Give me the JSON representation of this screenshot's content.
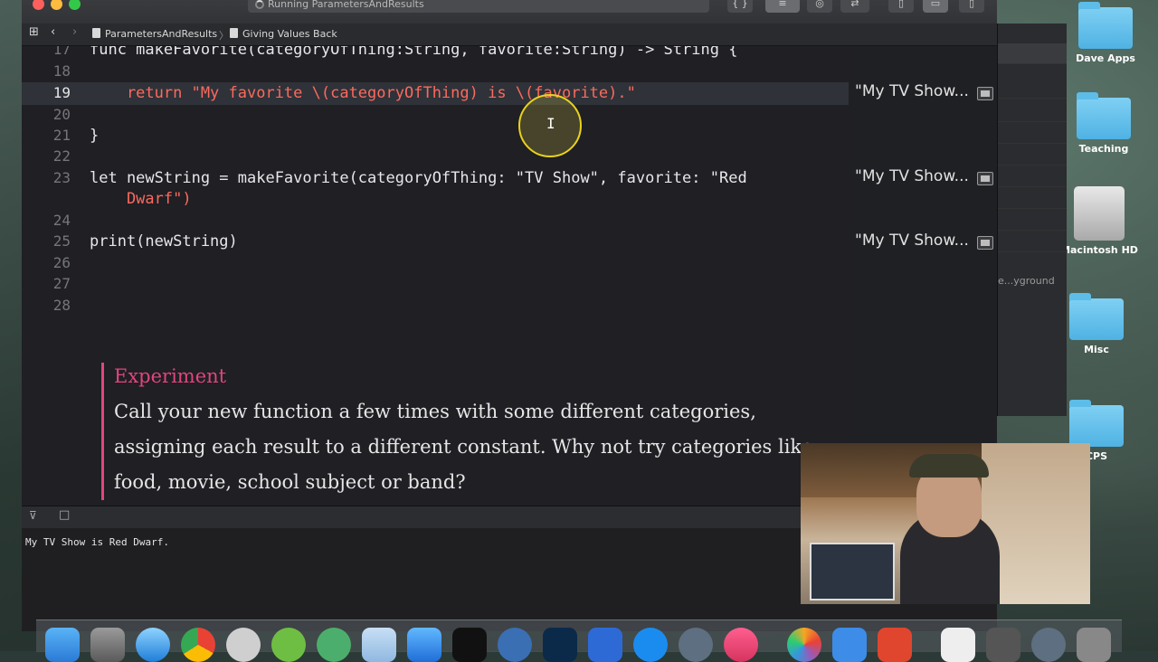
{
  "window": {
    "activity_text": "Running ParametersAndResults",
    "breadcrumb_project": "ParametersAndResults",
    "breadcrumb_page": "Giving Values Back",
    "toolbar_code_review": "{ }"
  },
  "editor": {
    "line_numbers": [
      "17",
      "18",
      "19",
      "20",
      "21",
      "22",
      "23",
      "",
      "24",
      "25",
      "26",
      "27",
      "28"
    ],
    "lines": {
      "l17": "func makeFavorite(categoryOfThing:String, favorite:String) -> String {",
      "l19": "    return \"My favorite \\(categoryOfThing) is \\(favorite).\"",
      "l21": "}",
      "l23a": "let newString = makeFavorite(categoryOfThing: \"TV Show\", favorite: \"Red",
      "l23b": "    Dwarf\")",
      "l25": "print(newString)"
    }
  },
  "results": [
    {
      "text": "\"My TV Show..."
    },
    {
      "text": "\"My TV Show..."
    },
    {
      "text": "\"My TV Show..."
    }
  ],
  "experiment": {
    "title": "Experiment",
    "body": "Call your new function a few times with some different categories, assigning each result to a different constant. Why not try categories like food, movie, school subject or band?"
  },
  "console": {
    "output": "My TV Show is Red Dwarf."
  },
  "background_window": {
    "label": "e...yground"
  },
  "desktop": {
    "icons": [
      "Dave Apps",
      "Teaching",
      "Macintosh HD",
      "Misc",
      "CPS"
    ]
  },
  "colors": {
    "keyword": "#fc5fa3",
    "string": "#fc6a5d",
    "type": "#5dd8ff",
    "function": "#67b7a4",
    "experiment_accent": "#e0467c"
  }
}
